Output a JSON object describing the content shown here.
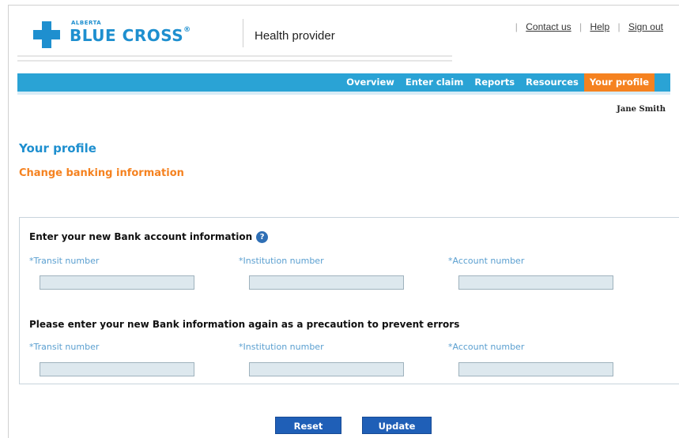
{
  "brand": {
    "small": "ALBERTA",
    "main": "BLUE CROSS",
    "reg": "®",
    "product": "Health provider",
    "logo_icon": "cross-icon",
    "brand_color": "#1e8fcf"
  },
  "top_links": {
    "contact": "Contact us",
    "help": "Help",
    "sign_out": "Sign out",
    "separator": "|"
  },
  "nav": {
    "items": [
      "Overview",
      "Enter claim",
      "Reports",
      "Resources",
      "Your profile"
    ],
    "active": "Your profile",
    "bar_color": "#2aa3d5",
    "active_color": "#f58220"
  },
  "user": {
    "name": "Jane Smith"
  },
  "page": {
    "title": "Your profile",
    "section": "Change banking information"
  },
  "form": {
    "group1_title": "Enter your new Bank account information",
    "group2_title": "Please enter your new Bank information again as a precaution to prevent errors",
    "help_icon": "question-circle-icon",
    "labels": {
      "transit": "*Transit number",
      "institution": "*Institution number",
      "account": "*Account number"
    },
    "values": {
      "transit": "",
      "institution": "",
      "account": "",
      "transit_confirm": "",
      "institution_confirm": "",
      "account_confirm": ""
    }
  },
  "buttons": {
    "reset": "Reset",
    "update": "Update"
  }
}
